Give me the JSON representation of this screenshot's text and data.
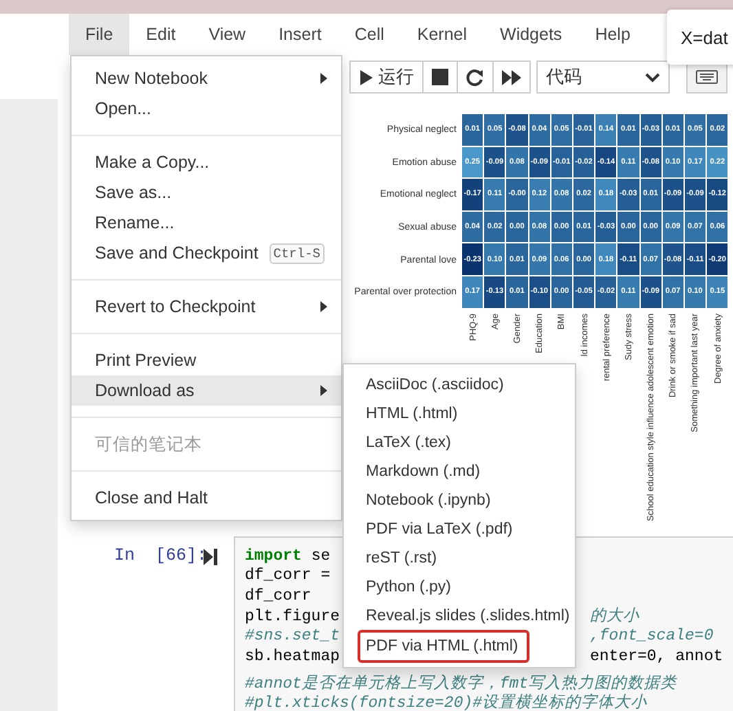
{
  "menubar": [
    {
      "label": "File",
      "selected": true
    },
    {
      "label": "Edit",
      "selected": false
    },
    {
      "label": "View",
      "selected": false
    },
    {
      "label": "Insert",
      "selected": false
    },
    {
      "label": "Cell",
      "selected": false
    },
    {
      "label": "Kernel",
      "selected": false
    },
    {
      "label": "Widgets",
      "selected": false
    },
    {
      "label": "Help",
      "selected": false
    }
  ],
  "tooltip": "X=dat",
  "toolbar": {
    "run_label": "运行",
    "cell_type": "代码"
  },
  "file_menu": [
    {
      "kind": "item",
      "label": "New Notebook",
      "submenu": true,
      "selected": false,
      "disabled": false
    },
    {
      "kind": "item",
      "label": "Open...",
      "submenu": false,
      "selected": false,
      "disabled": false
    },
    {
      "kind": "divider"
    },
    {
      "kind": "item",
      "label": "Make a Copy...",
      "submenu": false,
      "selected": false,
      "disabled": false
    },
    {
      "kind": "item",
      "label": "Save as...",
      "submenu": false,
      "selected": false,
      "disabled": false
    },
    {
      "kind": "item",
      "label": "Rename...",
      "submenu": false,
      "selected": false,
      "disabled": false
    },
    {
      "kind": "item",
      "label": "Save and Checkpoint",
      "shortcut": "Ctrl-S",
      "submenu": false,
      "selected": false,
      "disabled": false
    },
    {
      "kind": "divider"
    },
    {
      "kind": "item",
      "label": "Revert to Checkpoint",
      "submenu": true,
      "selected": false,
      "disabled": false
    },
    {
      "kind": "divider"
    },
    {
      "kind": "item",
      "label": "Print Preview",
      "submenu": false,
      "selected": false,
      "disabled": false
    },
    {
      "kind": "item",
      "label": "Download as",
      "submenu": true,
      "selected": true,
      "disabled": false
    },
    {
      "kind": "divider"
    },
    {
      "kind": "item",
      "label": "可信的笔记本",
      "submenu": false,
      "selected": false,
      "disabled": true
    },
    {
      "kind": "divider"
    },
    {
      "kind": "item",
      "label": "Close and Halt",
      "submenu": false,
      "selected": false,
      "disabled": false
    }
  ],
  "download_menu": [
    {
      "label": "AsciiDoc (.asciidoc)",
      "outlined": false
    },
    {
      "label": "HTML (.html)",
      "outlined": false
    },
    {
      "label": "LaTeX (.tex)",
      "outlined": false
    },
    {
      "label": "Markdown (.md)",
      "outlined": false
    },
    {
      "label": "Notebook (.ipynb)",
      "outlined": false
    },
    {
      "label": "PDF via LaTeX (.pdf)",
      "outlined": false
    },
    {
      "label": "reST (.rst)",
      "outlined": false
    },
    {
      "label": "Python (.py)",
      "outlined": false
    },
    {
      "label": "Reveal.js slides (.slides.html)",
      "outlined": false
    },
    {
      "label": "PDF via HTML (.html)",
      "outlined": true
    }
  ],
  "heatmap": {
    "columns": [
      "PHQ-9",
      "Age",
      "Gender",
      "Education",
      "BMI",
      "ld incomes",
      "rental preference",
      "Sudy stress",
      "School education style influence adolescent emotion",
      "Drink or smoke if sad",
      "Something important last year",
      "Degree of anxiety"
    ],
    "rows": [
      {
        "label": "Physical neglect",
        "values": [
          "0.01",
          "0.05",
          "-0.08",
          "0.04",
          "0.05",
          "-0.01",
          "0.14",
          "0.01",
          "-0.03",
          "0.01",
          "0.05",
          "0.02"
        ]
      },
      {
        "label": "Emotion abuse",
        "values": [
          "0.25",
          "-0.09",
          "0.08",
          "-0.09",
          "-0.01",
          "-0.02",
          "-0.14",
          "0.11",
          "-0.08",
          "0.10",
          "0.17",
          "0.22"
        ]
      },
      {
        "label": "Emotional neglect",
        "values": [
          "-0.17",
          "0.11",
          "-0.00",
          "0.12",
          "0.08",
          "0.02",
          "0.18",
          "-0.03",
          "0.01",
          "-0.09",
          "-0.09",
          "-0.12"
        ]
      },
      {
        "label": "Sexual abuse",
        "values": [
          "0.04",
          "0.02",
          "0.00",
          "0.08",
          "0.00",
          "0.01",
          "-0.03",
          "0.00",
          "0.00",
          "0.09",
          "0.07",
          "0.06"
        ]
      },
      {
        "label": "Parental love",
        "values": [
          "-0.23",
          "0.10",
          "0.01",
          "0.09",
          "0.06",
          "0.00",
          "0.18",
          "-0.11",
          "0.07",
          "-0.08",
          "-0.11",
          "-0.20"
        ]
      },
      {
        "label": "Parental over protection",
        "values": [
          "0.17",
          "-0.13",
          "0.01",
          "-0.10",
          "0.00",
          "-0.05",
          "-0.02",
          "0.11",
          "-0.09",
          "0.07",
          "0.10",
          "0.15"
        ]
      }
    ]
  },
  "cell": {
    "prompt": "In  [66]:",
    "lines": [
      {
        "left": [
          {
            "text": "import",
            "kind": "keyword"
          },
          {
            "text": " se",
            "kind": "name"
          }
        ]
      },
      {
        "left": [
          {
            "text": "df_corr =",
            "kind": "name"
          }
        ]
      },
      {
        "left": [
          {
            "text": "df_corr",
            "kind": "name"
          }
        ]
      },
      {
        "left": [
          {
            "text": "plt.figure",
            "kind": "name"
          }
        ],
        "right": [
          {
            "text": "的大小",
            "kind": "comment"
          }
        ]
      },
      {
        "left": [
          {
            "text": "#sns.set_t",
            "kind": "comment"
          }
        ],
        "right": [
          {
            "text": ",font_scale=0",
            "kind": "comment"
          }
        ]
      },
      {
        "left": [
          {
            "text": "sb.heatmap",
            "kind": "name"
          }
        ],
        "right": [
          {
            "text": "enter=0, annot",
            "kind": "name"
          }
        ]
      },
      {
        "left": [
          {
            "text": "#annot是否在单元格上写入数字，fmt写入热力图的数据类",
            "kind": "comment"
          }
        ]
      },
      {
        "left": [
          {
            "text": "#plt.xticks(fontsize=20)#设置横坐标的字体大小",
            "kind": "comment"
          }
        ]
      }
    ]
  }
}
